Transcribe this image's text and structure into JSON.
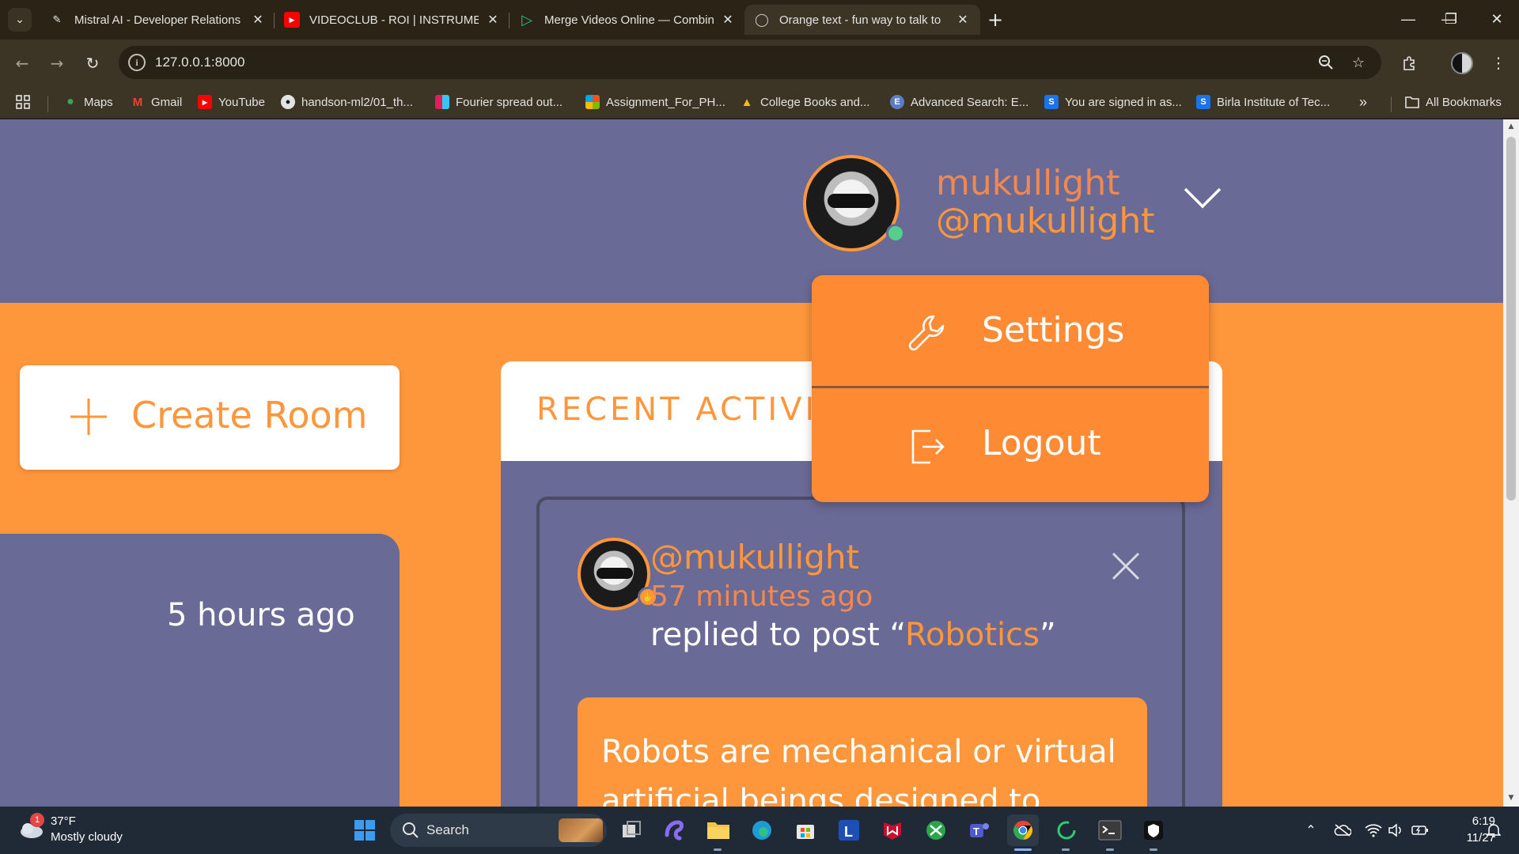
{
  "browser": {
    "tabs": [
      {
        "title": "Mistral AI - Developer Relations",
        "favicon": "mistral-icon",
        "active": false
      },
      {
        "title": "VIDEOCLUB - ROI | INSTRUMENTAL",
        "favicon": "youtube-icon",
        "active": false
      },
      {
        "title": "Merge Videos Online — Combine",
        "favicon": "clideo-icon",
        "active": false
      },
      {
        "title": "Orange text - fun way to talk to",
        "favicon": "globe-icon",
        "active": true
      }
    ],
    "url": "127.0.0.1:8000",
    "bookmarks": [
      {
        "label": "Maps",
        "icon": "maps-icon"
      },
      {
        "label": "Gmail",
        "icon": "gmail-icon"
      },
      {
        "label": "YouTube",
        "icon": "youtube-icon"
      },
      {
        "label": "handson-ml2/01_th...",
        "icon": "github-icon"
      },
      {
        "label": "Fourier spread out...",
        "icon": "slack-icon"
      },
      {
        "label": "Assignment_For_PH...",
        "icon": "microsoft-icon"
      },
      {
        "label": "College Books and...",
        "icon": "drive-icon"
      },
      {
        "label": "Advanced Search: E...",
        "icon": "e-icon"
      },
      {
        "label": "You are signed in as...",
        "icon": "s-icon"
      },
      {
        "label": "Birla Institute of Tec...",
        "icon": "s-icon"
      }
    ],
    "all_bookmarks_label": "All Bookmarks"
  },
  "page": {
    "header": {
      "username": "mukullight",
      "handle": "@mukullight"
    },
    "dropdown": {
      "items": [
        {
          "label": "Settings",
          "icon": "wrench-icon"
        },
        {
          "label": "Logout",
          "icon": "logout-icon"
        }
      ]
    },
    "create_room_label": "Create Room",
    "left_card_time": "5 hours ago",
    "activity": {
      "title": "RECENT ACTIVITIES",
      "post": {
        "handle": "@mukullight",
        "time": "57 minutes ago",
        "action_prefix": "replied to post “",
        "post_title": "Robotics",
        "action_suffix": "”",
        "body": "Robots are mechanical or virtual artificial beings designed to"
      }
    }
  },
  "taskbar": {
    "weather_temp": "37°F",
    "weather_desc": "Mostly cloudy",
    "weather_badge": "1",
    "search_label": "Search",
    "time": "6:19",
    "date": "11/27"
  },
  "colors": {
    "accent_orange": "#fe963b",
    "header_purple": "#6a6a96"
  }
}
